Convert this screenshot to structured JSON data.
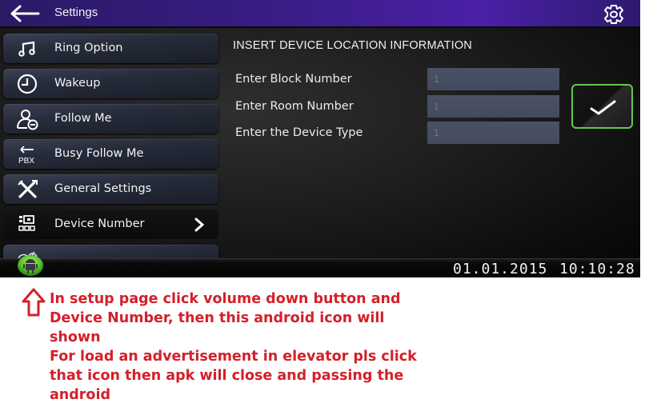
{
  "titlebar": {
    "title": "Settings",
    "back_icon": "arrow-left-icon",
    "settings_icon": "gear-icon"
  },
  "sidebar": {
    "items": [
      {
        "label": "Ring Option",
        "icon": "music-note-icon",
        "selected": false
      },
      {
        "label": "Wakeup",
        "icon": "clock-icon",
        "selected": false
      },
      {
        "label": "Follow Me",
        "icon": "user-forward-icon",
        "selected": false
      },
      {
        "label": "Busy Follow Me",
        "icon": "pbx-forward-icon",
        "icon_text": "PBX",
        "selected": false
      },
      {
        "label": "General Settings",
        "icon": "tools-icon",
        "selected": false
      },
      {
        "label": "Device Number",
        "icon": "device-grid-icon",
        "selected": true,
        "trailing_icon": "chevron-right-icon"
      },
      {
        "label": "",
        "icon": "partially-hidden-icon",
        "selected": false
      }
    ]
  },
  "main": {
    "section_title": "INSERT DEVICE LOCATION INFORMATION",
    "fields": [
      {
        "label": "Enter Block Number",
        "value": "",
        "placeholder": "1"
      },
      {
        "label": "Enter Room Number",
        "value": "",
        "placeholder": "1"
      },
      {
        "label": "Enter the Device Type",
        "value": "",
        "placeholder": "1"
      }
    ],
    "confirm_icon": "checkmark-icon"
  },
  "statusbar": {
    "date": "01.01.2015",
    "time": "10:10:28",
    "android_icon": "android-icon"
  },
  "annotation": {
    "arrow_icon": "arrow-up-outline-icon",
    "lines": [
      "In setup page click volume down button and",
      "Device Number, then this android icon will",
      "shown",
      "For load an advertisement in elevator pls click",
      "that icon then apk will close and passing the",
      "android"
    ]
  },
  "colors": {
    "titlebar": "#3a1d86",
    "confirm_border": "#63c74f",
    "android_green": "#5fc832",
    "annotation_red": "#d4202a",
    "input_bg": "#474d62"
  }
}
